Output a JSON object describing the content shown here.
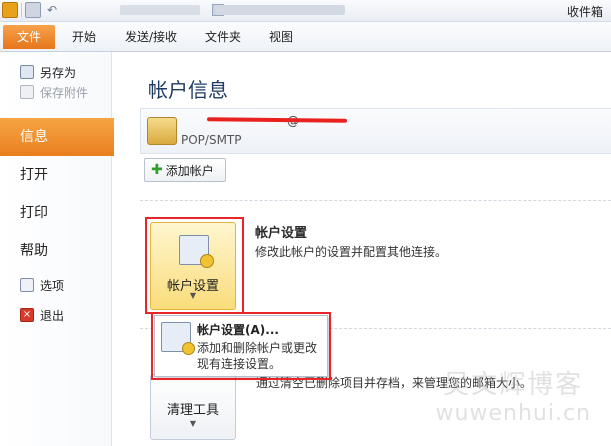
{
  "window": {
    "title": "收件箱"
  },
  "tabs": [
    {
      "label": "文件"
    },
    {
      "label": "开始"
    },
    {
      "label": "发送/接收"
    },
    {
      "label": "文件夹"
    },
    {
      "label": "视图"
    }
  ],
  "nav": {
    "save_as": "另存为",
    "save_attachments": "保存附件",
    "info": "信息",
    "open": "打开",
    "print": "打印",
    "help": "帮助",
    "options": "选项",
    "exit": "退出"
  },
  "main": {
    "title": "帐户信息",
    "account_email_visible": "@",
    "account_type": "POP/SMTP",
    "add_account": "添加帐户",
    "account_settings_button": "帐户设置",
    "account_settings_title": "帐户设置",
    "account_settings_desc": "修改此帐户的设置并配置其他连接。",
    "cleanup_button": "清理工具",
    "cleanup_desc": "通过清空已删除项目并存档，来管理您的邮箱大小。"
  },
  "dropdown": {
    "title": "帐户设置(A)...",
    "desc": "添加和删除帐户或更改现有连接设置。"
  },
  "watermark": {
    "line1": "吴文辉博客",
    "line2": "wuwenhui.cn"
  },
  "colors": {
    "accent_orange": "#ea7f1f",
    "highlight_red": "#e8262a",
    "title_blue": "#1f3b63"
  },
  "icons": [
    "outlook-icon",
    "save-icon",
    "undo-icon",
    "save-as-icon",
    "attachment-icon",
    "options-icon",
    "exit-icon",
    "account-icon",
    "plus-icon",
    "account-settings-icon",
    "cleanup-icon"
  ]
}
